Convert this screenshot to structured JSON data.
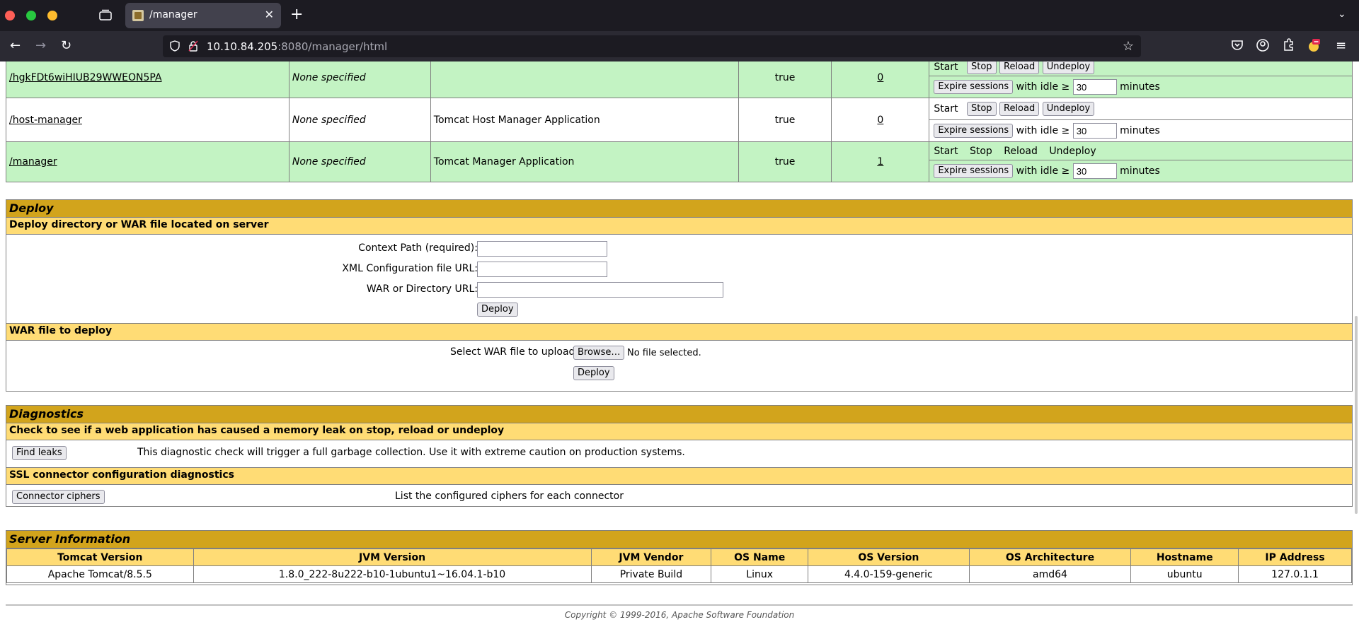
{
  "browser": {
    "tab_title": "/manager",
    "url_host": "10.10.84.205",
    "url_rest": ":8080/manager/html"
  },
  "applications": [
    {
      "path": "/hgkFDt6wiHIUB29WWEON5PA",
      "version": "None specified",
      "display_name": "",
      "running": "true",
      "sessions": "0",
      "commands": [
        "Start",
        "Stop",
        "Reload",
        "Undeploy"
      ],
      "commands_as_buttons": [
        "Stop",
        "Reload",
        "Undeploy"
      ],
      "idle": "30"
    },
    {
      "path": "/host-manager",
      "version": "None specified",
      "display_name": "Tomcat Host Manager Application",
      "running": "true",
      "sessions": "0",
      "commands": [
        "Start",
        "Stop",
        "Reload",
        "Undeploy"
      ],
      "idle": "30"
    },
    {
      "path": "/manager",
      "version": "None specified",
      "display_name": "Tomcat Manager Application",
      "running": "true",
      "sessions": "1",
      "commands": [
        "Start",
        "Stop",
        "Reload",
        "Undeploy"
      ],
      "idle": "30"
    }
  ],
  "expire": {
    "button": "Expire sessions",
    "with_idle": "with idle ≥",
    "minutes": "minutes"
  },
  "deploy": {
    "title": "Deploy",
    "server_sub": "Deploy directory or WAR file located on server",
    "context_label": "Context Path (required):",
    "xml_label": "XML Configuration file URL:",
    "war_dir_label": "WAR or Directory URL:",
    "deploy_button": "Deploy",
    "war_sub": "WAR file to deploy",
    "select_label": "Select WAR file to upload",
    "browse_button": "Browse…",
    "no_file": "No file selected.",
    "deploy_button_2": "Deploy"
  },
  "diagnostics": {
    "title": "Diagnostics",
    "leak_sub": "Check to see if a web application has caused a memory leak on stop, reload or undeploy",
    "find_leaks_button": "Find leaks",
    "find_leaks_text": "This diagnostic check will trigger a full garbage collection. Use it with extreme caution on production systems.",
    "ssl_sub": "SSL connector configuration diagnostics",
    "ciphers_button": "Connector ciphers",
    "ciphers_text": "List the configured ciphers for each connector"
  },
  "server_info": {
    "title": "Server Information",
    "headers": [
      "Tomcat Version",
      "JVM Version",
      "JVM Vendor",
      "OS Name",
      "OS Version",
      "OS Architecture",
      "Hostname",
      "IP Address"
    ],
    "values": [
      "Apache Tomcat/8.5.5",
      "1.8.0_222-8u222-b10-1ubuntu1~16.04.1-b10",
      "Private Build",
      "Linux",
      "4.4.0-159-generic",
      "amd64",
      "ubuntu",
      "127.0.1.1"
    ]
  },
  "footer": "Copyright © 1999-2016, Apache Software Foundation"
}
